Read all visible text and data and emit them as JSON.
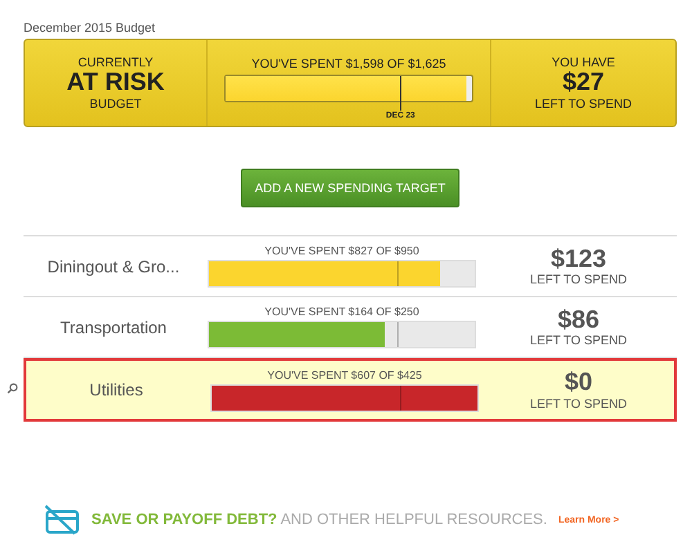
{
  "budget": {
    "title": "December 2015 Budget",
    "status": {
      "top": "CURRENTLY",
      "value": "AT RISK",
      "bottom": "BUDGET"
    },
    "progress": {
      "label": "YOU'VE SPENT $1,598 OF $1,625",
      "level": 0.98,
      "color": "#fbd52e",
      "marker": {
        "label": "DEC 23",
        "level": 0.71
      }
    },
    "remaining": {
      "top": "YOU HAVE",
      "value": "$27",
      "bottom": "LEFT TO SPEND"
    }
  },
  "add_button": "ADD A NEW SPENDING TARGET",
  "targets": [
    {
      "name": "Diningout & Gro...",
      "spent": "YOU'VE SPENT $827 OF $950",
      "level": 0.87,
      "color": "#fbd52e",
      "marker": {
        "level": 0.71
      },
      "amount": "$123",
      "amount_label": "LEFT TO SPEND",
      "highlighted": false
    },
    {
      "name": "Transportation",
      "spent": "YOU'VE SPENT $164 OF $250",
      "level": 0.66,
      "color": "#7cbb36",
      "marker": {
        "level": 0.71
      },
      "amount": "$86",
      "amount_label": "LEFT TO SPEND",
      "highlighted": false
    },
    {
      "name": "Utilities",
      "spent": "YOU'VE SPENT $607 OF $425",
      "level": 1,
      "color": "#c8262a",
      "marker": {
        "level": 0.71
      },
      "amount": "$0",
      "amount_label": "LEFT TO SPEND",
      "highlighted": true
    }
  ],
  "footer": {
    "text": "**SAVE OR PAYOFF DEBT?** AND OTHER HELPFUL RESOURCES.",
    "link": "Learn More >"
  }
}
